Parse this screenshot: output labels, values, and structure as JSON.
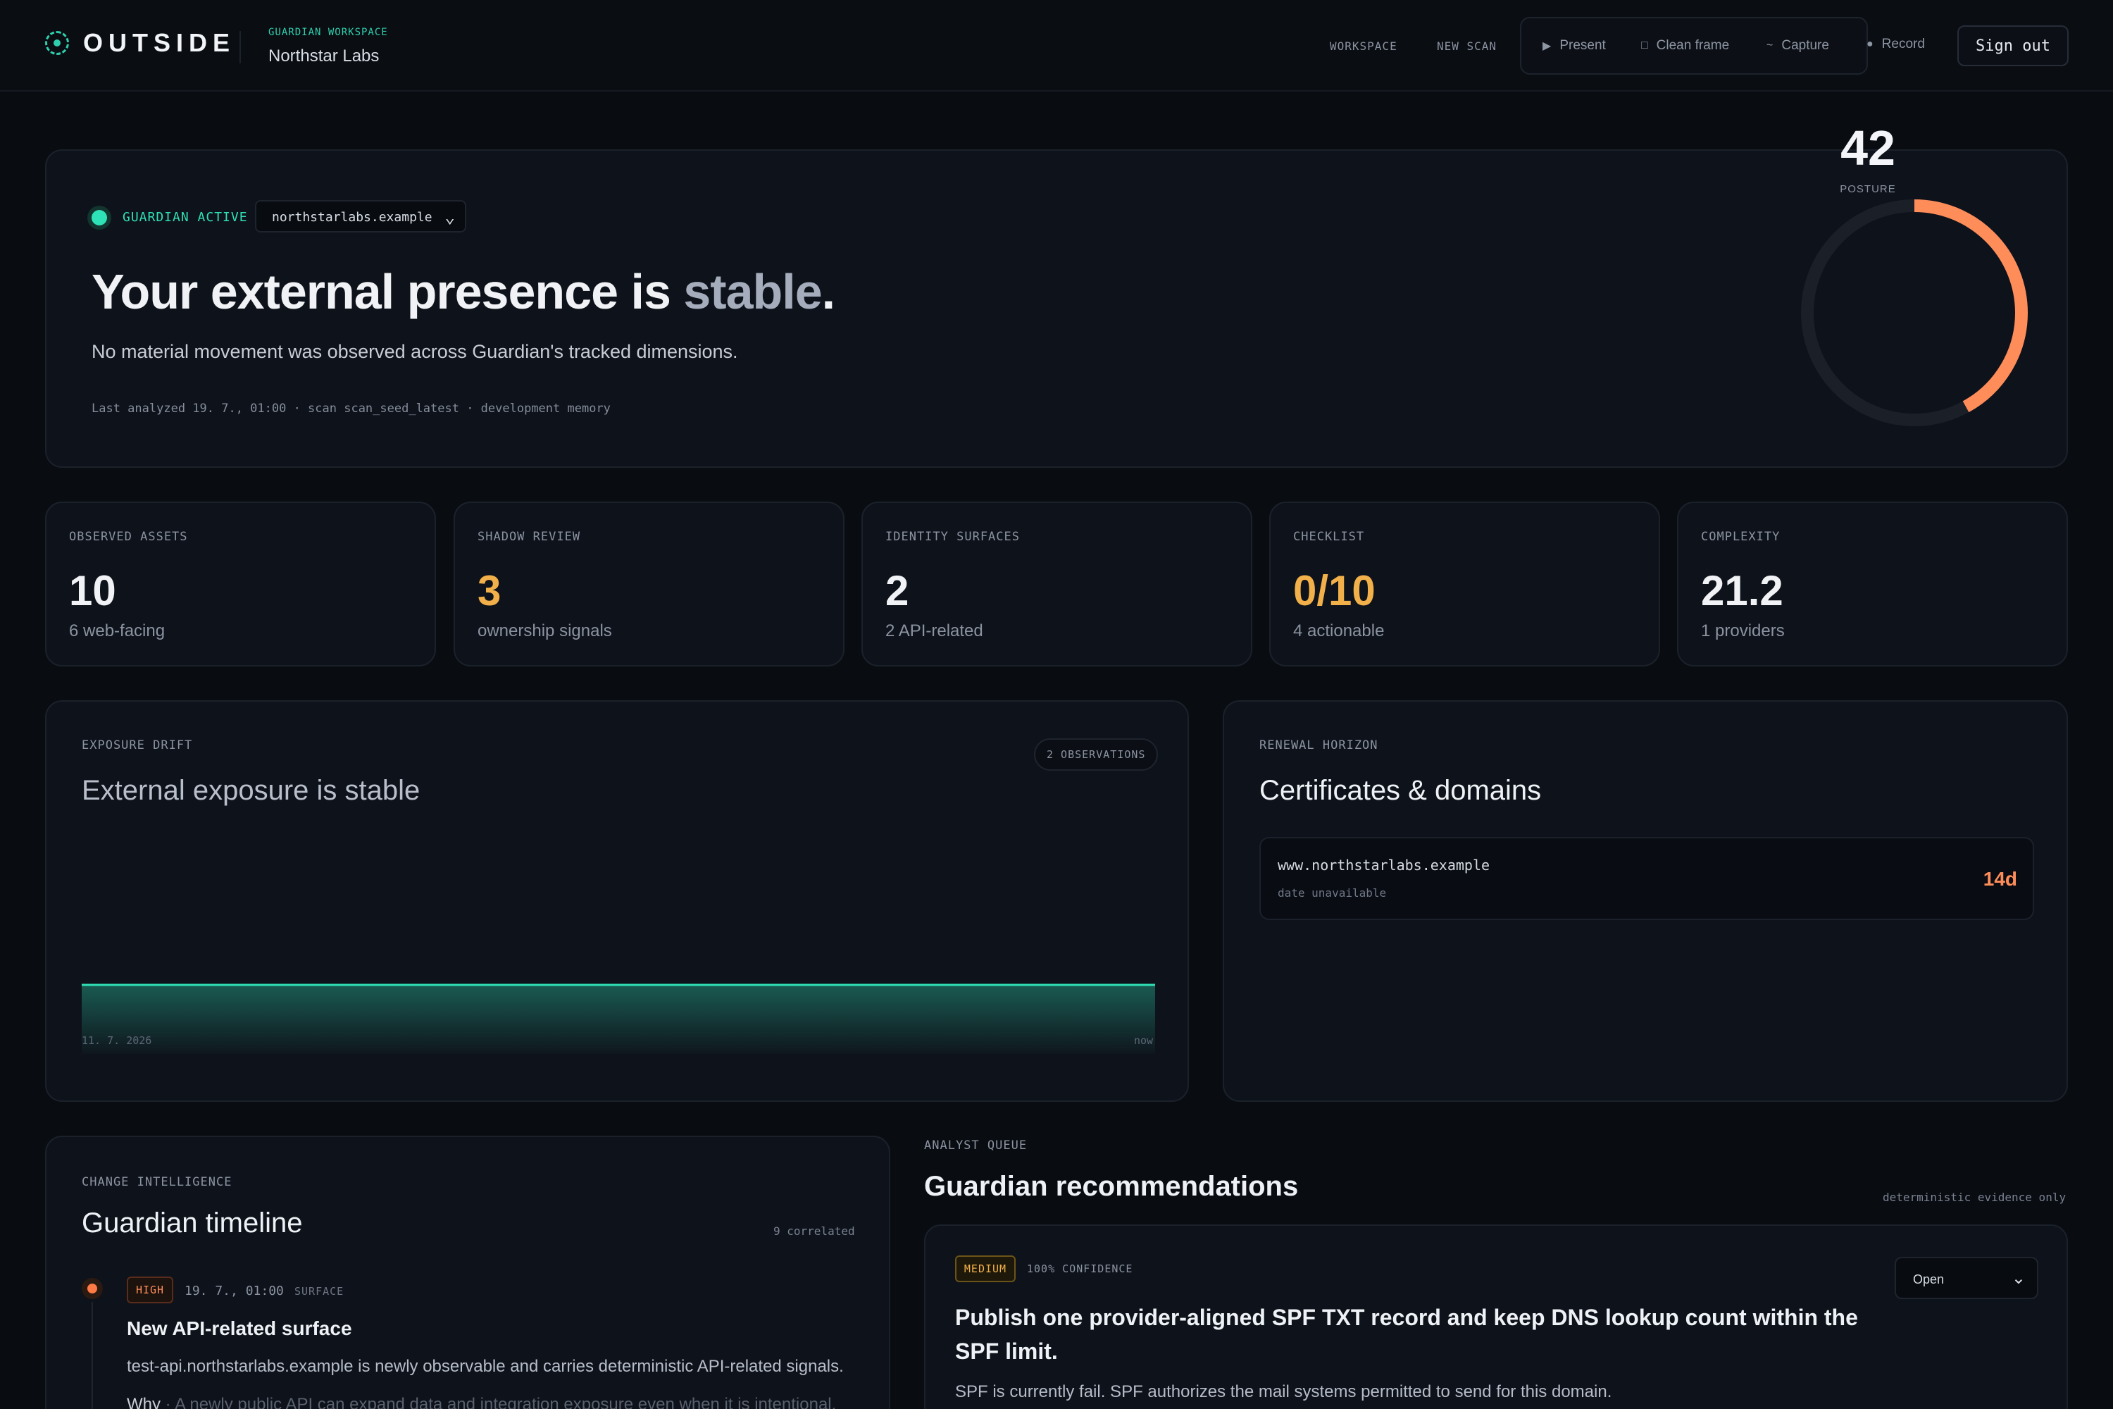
{
  "header": {
    "brand": "OUTSIDE",
    "workspace_kicker": "GUARDIAN WORKSPACE",
    "workspace_name": "Northstar Labs",
    "nav": [
      "WORKSPACE",
      "NEW SCAN"
    ],
    "tools": {
      "present": "Present",
      "clean_frame": "Clean frame",
      "capture": "Capture",
      "record": "Record"
    },
    "sign_out": "Sign out"
  },
  "hero": {
    "status": "GUARDIAN ACTIVE",
    "domain": "northstarlabs.example",
    "title_main": "Your external presence is ",
    "title_accent": "stable",
    "title_end": ".",
    "subtitle": "No material movement was observed across Guardian's tracked dimensions.",
    "meta": "Last analyzed 19. 7., 01:00 · scan scan_seed_latest · development memory",
    "posture_value": "42",
    "posture_label": "POSTURE",
    "posture_score": 42,
    "posture_max": 100
  },
  "stats": [
    {
      "label": "OBSERVED ASSETS",
      "value": "10",
      "sub": "6 web-facing"
    },
    {
      "label": "SHADOW REVIEW",
      "value": "3",
      "sub": "ownership signals"
    },
    {
      "label": "IDENTITY SURFACES",
      "value": "2",
      "sub": "2 API-related"
    },
    {
      "label": "CHECKLIST",
      "value": "0/10",
      "sub": "4 actionable"
    },
    {
      "label": "COMPLEXITY",
      "value": "21.2",
      "sub": "1 providers"
    }
  ],
  "drift": {
    "label": "EXPOSURE DRIFT",
    "title": "External exposure is stable",
    "pill": "2 OBSERVATIONS",
    "x_start": "11. 7. 2026",
    "x_end": "now"
  },
  "renewal": {
    "label": "RENEWAL HORIZON",
    "title": "Certificates & domains",
    "items": [
      {
        "host": "www.northstarlabs.example",
        "date": "date unavailable",
        "days": "14d"
      }
    ]
  },
  "timeline": {
    "label": "CHANGE INTELLIGENCE",
    "title": "Guardian timeline",
    "count": "9 correlated",
    "event": {
      "severity": "HIGH",
      "time": "19. 7., 01:00",
      "tag": "SURFACE",
      "title": "New API-related surface",
      "desc": "test-api.northstarlabs.example is newly observable and carries deterministic API-related signals.",
      "why_label": "Why",
      "why_text": " · A newly public API can expand data and integration exposure even when it is intentional."
    }
  },
  "recommendations": {
    "label": "ANALYST QUEUE",
    "title": "Guardian recommendations",
    "note": "deterministic evidence only",
    "item": {
      "severity": "MEDIUM",
      "confidence": "100% CONFIDENCE",
      "status": "Open",
      "title": "Publish one provider-aligned SPF TXT record and keep DNS lookup count within the SPF limit.",
      "body": "SPF is currently fail. SPF authorizes the mail systems permitted to send for this domain."
    }
  },
  "colors": {
    "accent": "#2fe1b7",
    "warning": "#f2b04a",
    "danger": "#ff8d5a",
    "background": "#090c11"
  },
  "chart_data": {
    "type": "area",
    "x": [
      "11. 7. 2026",
      "now"
    ],
    "values": [
      0,
      0
    ],
    "xlabel": "",
    "ylabel": ""
  }
}
